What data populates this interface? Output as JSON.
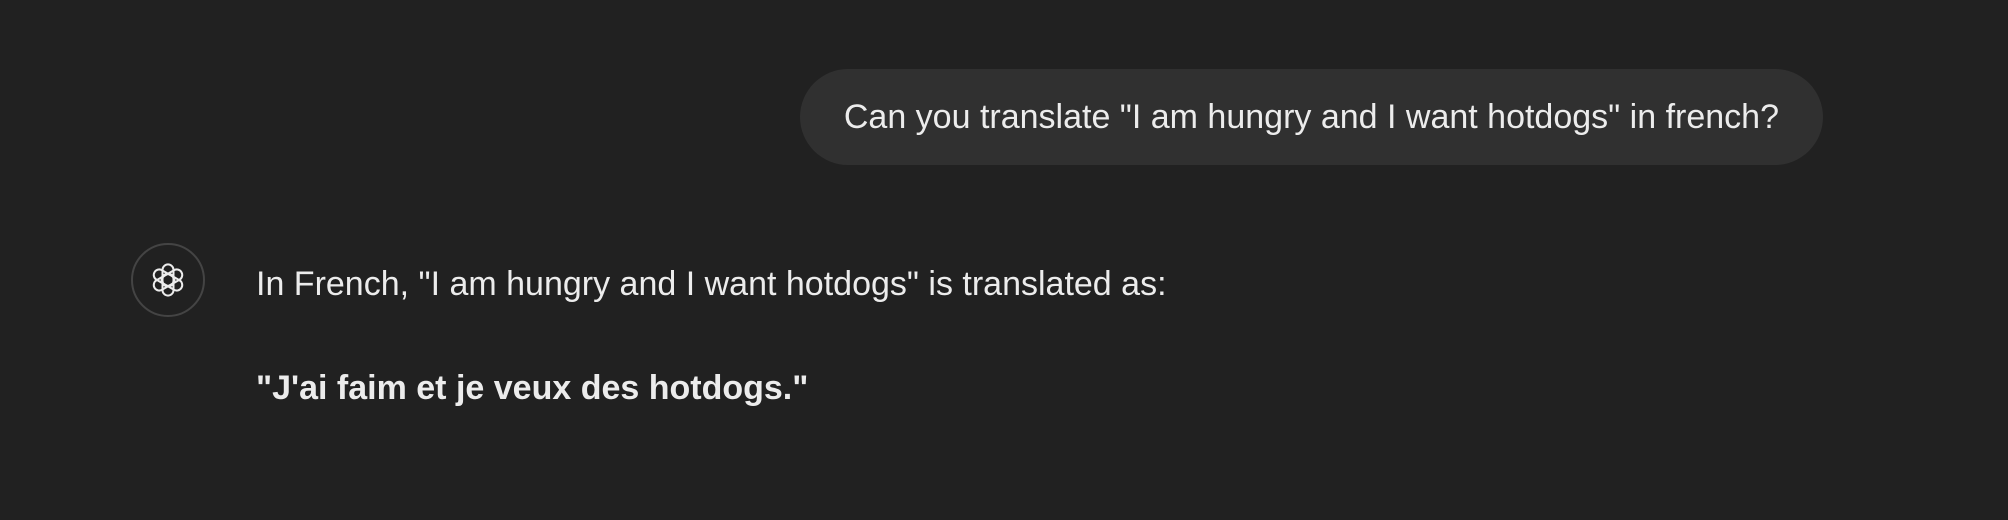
{
  "conversation": {
    "user_message": "Can you translate \"I am hungry and I want hotdogs\" in french?",
    "assistant": {
      "avatar_icon": "openai-logo-icon",
      "intro": "In French, \"I am hungry and I want hotdogs\" is translated as:",
      "translation": "\"J'ai faim et je veux des hotdogs.\""
    }
  },
  "colors": {
    "background": "#212121",
    "user_bubble": "#303030",
    "text": "#ececec",
    "avatar_border": "#444444"
  }
}
